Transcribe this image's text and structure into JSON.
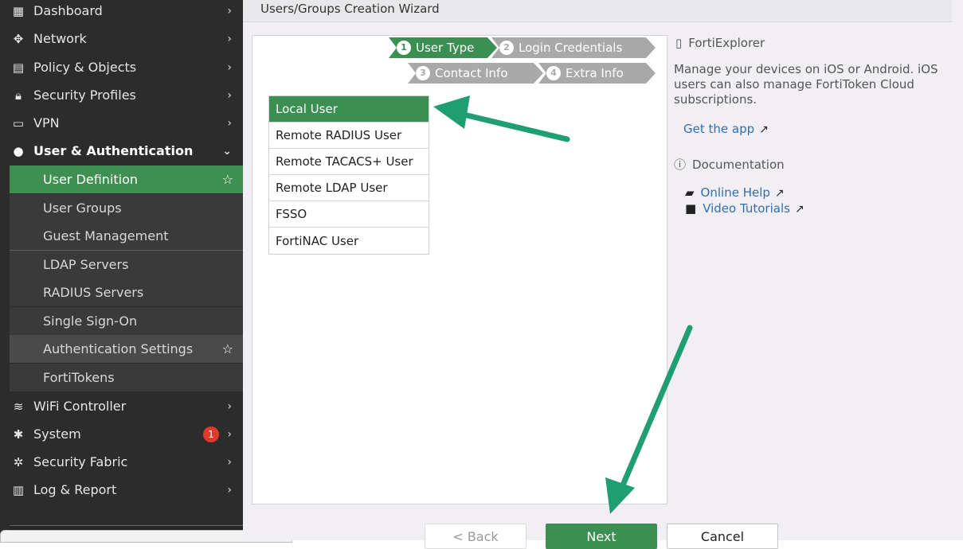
{
  "sidebar": {
    "items": [
      {
        "label": "Dashboard",
        "icon": "dashboard-icon"
      },
      {
        "label": "Network",
        "icon": "network-icon"
      },
      {
        "label": "Policy & Objects",
        "icon": "policy-icon"
      },
      {
        "label": "Security Profiles",
        "icon": "lock-icon"
      },
      {
        "label": "VPN",
        "icon": "laptop-icon"
      },
      {
        "label": "User & Authentication",
        "icon": "user-icon"
      }
    ],
    "sub_items": [
      {
        "label": "User Definition"
      },
      {
        "label": "User Groups"
      },
      {
        "label": "Guest Management"
      },
      {
        "label": "LDAP Servers"
      },
      {
        "label": "RADIUS Servers"
      },
      {
        "label": "Single Sign-On"
      },
      {
        "label": "Authentication Settings"
      },
      {
        "label": "FortiTokens"
      }
    ],
    "lower_items": [
      {
        "label": "WiFi Controller",
        "icon": "wifi-icon"
      },
      {
        "label": "System",
        "icon": "gear-icon",
        "badge": "1"
      },
      {
        "label": "Security Fabric",
        "icon": "fabric-icon"
      },
      {
        "label": "Log & Report",
        "icon": "chart-icon"
      }
    ]
  },
  "header": {
    "title": "Users/Groups Creation Wizard"
  },
  "steps": [
    {
      "num": "1",
      "label": "User Type"
    },
    {
      "num": "2",
      "label": "Login Credentials"
    },
    {
      "num": "3",
      "label": "Contact Info"
    },
    {
      "num": "4",
      "label": "Extra Info"
    }
  ],
  "user_types": [
    "Local User",
    "Remote RADIUS User",
    "Remote TACACS+ User",
    "Remote LDAP User",
    "FSSO",
    "FortiNAC User"
  ],
  "info": {
    "fortiexplorer_title": "FortiExplorer",
    "fortiexplorer_desc": "Manage your devices on iOS or Android. iOS users can also manage FortiToken Cloud subscriptions.",
    "get_app": "Get the app",
    "documentation": "Documentation",
    "online_help": "Online Help",
    "video_tutorials": "Video Tutorials"
  },
  "buttons": {
    "back": "< Back",
    "next": "Next",
    "cancel": "Cancel"
  },
  "colors": {
    "accent": "#3c8f52",
    "sidebar_bg": "#2c2c2c",
    "arrow": "#1f9e72",
    "badge": "#e03a2f"
  }
}
